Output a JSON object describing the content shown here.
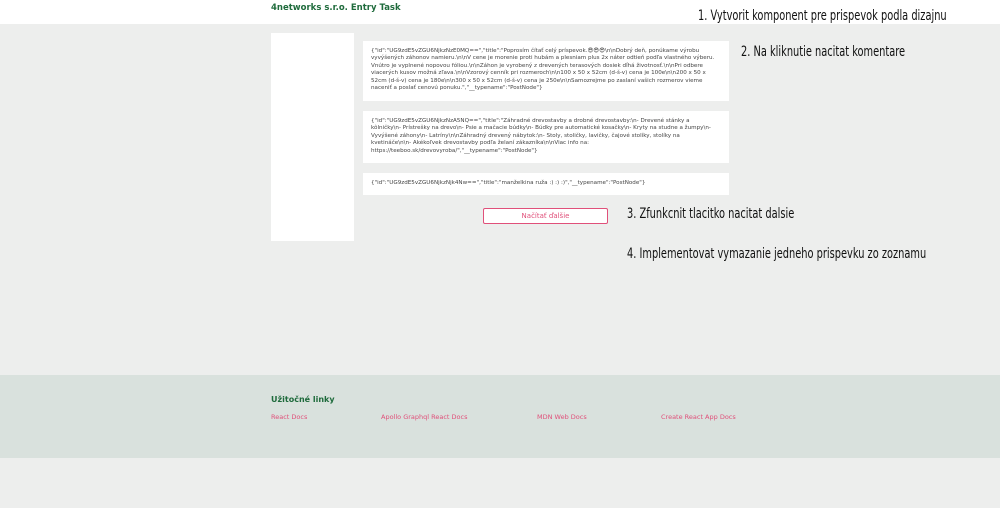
{
  "header": {
    "brand": "4networks s.r.o. Entry Task"
  },
  "tasks": [
    "1. Vytvorit komponent pre prispevok podla dizajnu",
    "2. Na kliknutie nacitat komentare",
    "3. Zfunkcnit tlacitko nacitat dalsie",
    "4. Implementovat vymazanie jedneho prispevku zo zoznamu"
  ],
  "posts": [
    {
      "raw": "{\"id\":\"UG9zdE5vZGU6NjkzNzE0MQ==\",\"title\":\"Poprosím čítať celý príspevok.😎😎😎\\n\\nDobrý deň, ponúkame výrobu vyvýšených záhonov namieru.\\n\\nV cene je morenie proti hubám a plesniam plus 2x náter odtieň podľa vlastného výberu. Vnútro je vyplnené nopovou fóliou.\\n\\nZáhon je vyrobený z drevených terasových dosiek dĺhá životnosť.\\n\\nPri odbere viacerých kusov možná zľava.\\n\\nVzorový cenník pri rozmeroch\\n\\n100 x 50 x 52cm (d-š-v) cena je 100e\\n\\n200 x 50 x 52cm (d-š-v) cena je 180e\\n\\n300 x 50 x 52cm (d-š-v) cena je 250e\\n\\nSamozrejme po zaslaní vašich rozmerov vieme naceniť a poslať cenovú ponuku.\",\"__typename\":\"PostNode\"}"
    },
    {
      "raw": "{\"id\":\"UG9zdE5vZGU6NjkzNzA5NQ==\",\"title\":\"Záhradné drevostavby a drobné drevostavby:\\n- Drevené stánky a kôlničky\\n- Prístrešky na drevo\\n- Psie a mačacie búdky\\n- Búdky pre automatické kosačky\\n- Kryty na studne a žumpy\\n- Vyvýšené záhony\\n- Latríny\\n\\nZáhradný drevený nábytok:\\n- Stoly, stoličky, lavičky, čajové stolíky, stolíky na kvetináče\\n\\n- Akékoľvek drevostavby podľa želaní zákazníka\\n\\nViac info na: https://teeboo.sk/drevovyroba/\",\"__typename\":\"PostNode\"}"
    },
    {
      "raw": "{\"id\":\"UG9zdE5vZGU6NjkzNjk4Nw==\",\"title\":\"manželkina ruža :) :) :)\",\"__typename\":\"PostNode\"}"
    }
  ],
  "load_more_label": "Načítať ďalšie",
  "footer": {
    "title": "Užitočné linky",
    "links": [
      "React Docs",
      "Apollo Graphql React Docs",
      "MDN Web Docs",
      "Create React App Docs"
    ]
  },
  "colors": {
    "accent": "#e0507a",
    "brand": "#1f6b3c",
    "page_bg": "#edeeed",
    "footer_bg": "#d9e1dd"
  }
}
